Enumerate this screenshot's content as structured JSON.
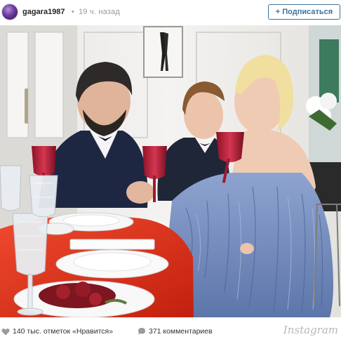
{
  "header": {
    "username": "gagara1987",
    "separator": "•",
    "timestamp": "19 ч. назад",
    "follow_label": "+ Подписаться"
  },
  "footer": {
    "likes": "140 тыс. отметок «Нравится»",
    "comments": "371 комментариев",
    "brand": "Instagram"
  },
  "icons": {
    "avatar": "profile-avatar",
    "like": "heart-icon",
    "comment": "comment-bubble-icon"
  },
  "colors": {
    "follow_blue": "#3f729b",
    "table_red": "#e0301e",
    "dress_blue": "#6e87b8",
    "glass_red": "#b81f3a"
  }
}
